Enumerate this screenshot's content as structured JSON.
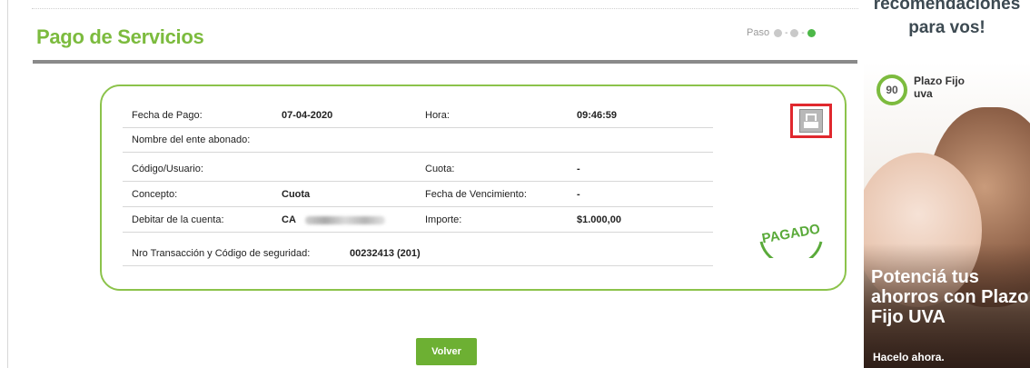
{
  "header": {
    "title": "Pago de Servicios",
    "steps_label": "Paso"
  },
  "receipt": {
    "fecha_pago_label": "Fecha de Pago:",
    "fecha_pago_value": "07-04-2020",
    "hora_label": "Hora:",
    "hora_value": "09:46:59",
    "ente_label": "Nombre del ente abonado:",
    "codigo_label": "Código/Usuario:",
    "cuota_label": "Cuota:",
    "cuota_value": "-",
    "concepto_label": "Concepto:",
    "concepto_value": "Cuota",
    "vencimiento_label": "Fecha de Vencimiento:",
    "vencimiento_value": "-",
    "cuenta_label": "Debitar de la cuenta:",
    "cuenta_value": "CA",
    "importe_label": "Importe:",
    "importe_value": "$1.000,00",
    "transaccion_label": "Nro Transacción y Código de seguridad:",
    "transaccion_value": "00232413 (201)",
    "stamp": "PAGADO"
  },
  "actions": {
    "volver_label": "Volver"
  },
  "sidebar": {
    "heading_line1": "recomendaciones",
    "heading_line2": "para vos!",
    "ad": {
      "badge_number": "90",
      "badge_line1": "Plazo Fijo",
      "badge_line2": "uva",
      "title": "Potenciá tus ahorros con Plazo Fijo UVA",
      "cta": "Hacelo ahora."
    }
  },
  "colors": {
    "brand_green": "#7cbb3e",
    "button_green": "#6db033",
    "highlight_red": "#e0282e"
  },
  "icons": [
    "print-icon",
    "step-dot-icon"
  ]
}
